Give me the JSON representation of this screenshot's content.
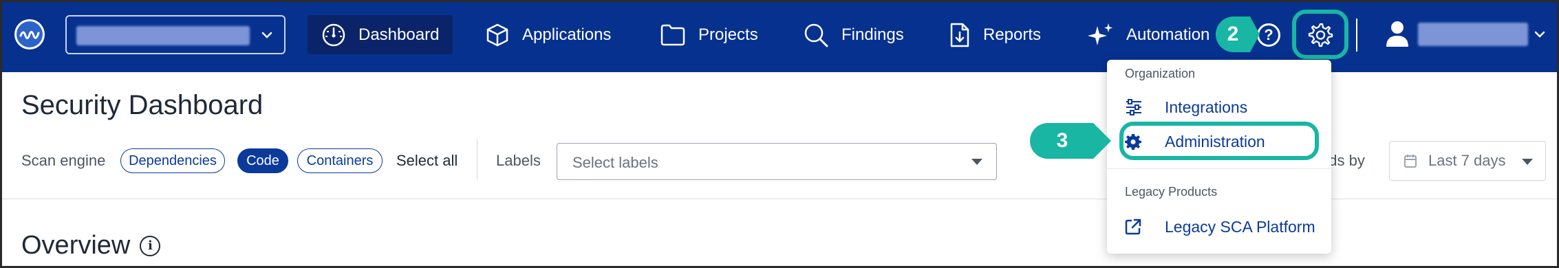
{
  "nav": {
    "items": [
      {
        "label": "Dashboard",
        "icon": "dashboard-gauge-icon"
      },
      {
        "label": "Applications",
        "icon": "cube-icon"
      },
      {
        "label": "Projects",
        "icon": "folder-icon"
      },
      {
        "label": "Findings",
        "icon": "search-icon"
      },
      {
        "label": "Reports",
        "icon": "report-download-icon"
      },
      {
        "label": "Automation",
        "icon": "sparkle-icon"
      }
    ],
    "help_symbol": "?",
    "colors": {
      "bar": "#06318f",
      "active": "#0b2469",
      "highlight": "#18b6a3"
    }
  },
  "callouts": {
    "step2": "2",
    "step3": "3"
  },
  "page": {
    "title": "Security Dashboard",
    "scan_engine_label": "Scan engine",
    "chips": [
      "Dependencies",
      "Code",
      "Containers"
    ],
    "select_all": "Select all",
    "labels_label": "Labels",
    "labels_placeholder": "Select labels",
    "trends_label": "nds by",
    "date_value": "Last 7 days",
    "overview": "Overview",
    "info_symbol": "i"
  },
  "menu": {
    "section1": "Organization",
    "integrations": "Integrations",
    "administration": "Administration",
    "section2": "Legacy Products",
    "legacy": "Legacy SCA Platform"
  }
}
